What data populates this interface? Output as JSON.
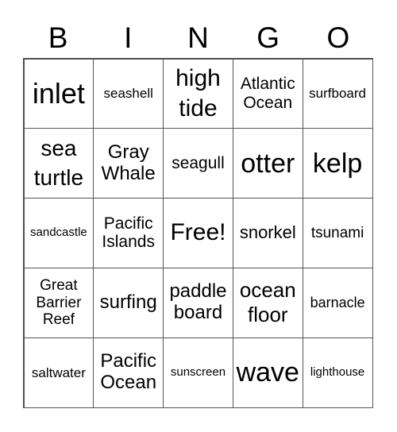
{
  "header": {
    "letters": [
      "B",
      "I",
      "N",
      "G",
      "O"
    ]
  },
  "grid": {
    "rows": [
      [
        "inlet",
        "seashell",
        "high tide",
        "Atlantic Ocean",
        "surfboard"
      ],
      [
        "sea turtle",
        "Gray Whale",
        "seagull",
        "otter",
        "kelp"
      ],
      [
        "sandcastle",
        "Pacific Islands",
        "Free!",
        "snorkel",
        "tsunami"
      ],
      [
        "Great Barrier Reef",
        "surfing",
        "paddle board",
        "ocean floor",
        "barnacle"
      ],
      [
        "saltwater",
        "Pacific Ocean",
        "sunscreen",
        "wave",
        "lighthouse"
      ]
    ]
  },
  "colors": {
    "background": "#ffffff",
    "text": "#000000",
    "grid_line": "#555555"
  }
}
